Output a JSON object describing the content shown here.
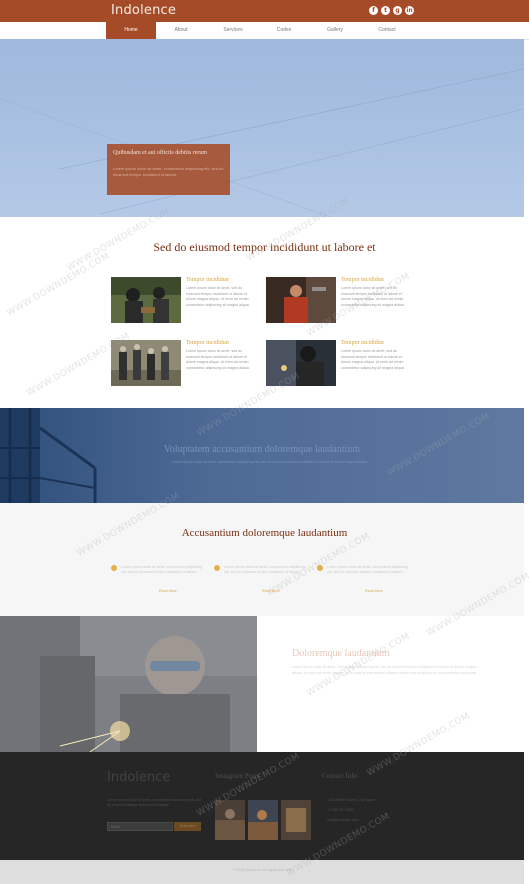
{
  "header": {
    "logo": "Indolence",
    "social_icons": [
      "facebook-icon",
      "twitter-icon",
      "google-plus-icon",
      "linkedin-icon"
    ],
    "accent_color": "#a64b27"
  },
  "nav": {
    "items": [
      {
        "label": "Home",
        "active": true
      },
      {
        "label": "About",
        "active": false
      },
      {
        "label": "Services",
        "active": false
      },
      {
        "label": "Codes",
        "active": false
      },
      {
        "label": "Gallery",
        "active": false
      },
      {
        "label": "Contact",
        "active": false
      }
    ]
  },
  "hero": {
    "title": "Quibusdam et aut officiis debitis rerum",
    "text": "Lorem ipsum dolor sit amet, consectetur adipiscing elit, sed do eiusmod tempor incididunt ut labore."
  },
  "features": {
    "heading": "Sed do eiusmod tempor incididunt ut labore et",
    "items": [
      {
        "title": "Tempor incididun",
        "text": "Lorem ipsum dolor sit amet, sed do eiusmod tempor incididunt ut labore et dolore magna aliqua. Ut enim ad minim consectetur adipiscing sit magna aliqua."
      },
      {
        "title": "Tempor incididun",
        "text": "Lorem ipsum dolor sit amet, sed do eiusmod tempor incididunt ut labore et dolore magna aliqua. Ut enim ad minim consectetur adipiscing sit magna aliqua."
      },
      {
        "title": "Tempor incididun",
        "text": "Lorem ipsum dolor sit amet, sed do eiusmod tempor incididunt ut labore et dolore magna aliqua. Ut enim ad minim consectetur adipiscing sit magna aliqua."
      },
      {
        "title": "Tempor incididun",
        "text": "Lorem ipsum dolor sit amet, sed do eiusmod tempor incididunt ut labore et dolore magna aliqua. Ut enim ad minim consectetur adipiscing sit magna aliqua."
      }
    ]
  },
  "banner": {
    "title": "Voluptatem accusantium doloremque laudantium",
    "text": "Lorem ipsum dolor sit amet, consectetur adipiscing elit, sed do eiusmod tempor incididunt ut labore et dolore magna aliqua."
  },
  "services": {
    "heading": "Accusantium doloremque laudantium",
    "items": [
      {
        "text": "Lorem ipsum dolor sit amet, consectetur adipiscing elit, sed do eiusmod tempor incididunt ut labore.",
        "more": "Read More"
      },
      {
        "text": "Lorem ipsum dolor sit amet, consectetur adipiscing elit, sed do eiusmod tempor incididunt ut labore.",
        "more": "Read More"
      },
      {
        "text": "Lorem ipsum dolor sit amet, consectetur adipiscing elit, sed do eiusmod tempor incididunt ut labore.",
        "more": "Read More"
      }
    ]
  },
  "about": {
    "title": "Doloremque laudantium",
    "text": "Lorem ipsum dolor sit amet, consectetur adipiscing elit, sed do eiusmod tempor incididunt ut labore et dolore magna aliqua. Ut enim ad minim veniam, quis nostrud exercitation ullamco laboris nisi ut aliquip ex ea commodo consequat."
  },
  "footer": {
    "logo": "Indolence",
    "text": "Lorem ipsum dolor sit amet, consectetur adipiscing elit, sed do eiusmod tempor incididunt ut labore.",
    "email_placeholder": "Email",
    "subscribe_label": "Subscribe",
    "instagram_heading": "Instagram Posts",
    "contact_heading": "Contact Info",
    "contact_lines": [
      "1234 Street Name, City Name",
      "+1 234 567 8900",
      "mail@example.com"
    ]
  },
  "bottom_bar": {
    "text": "© 2016 Indolence. All rights reserved"
  },
  "watermark": "WWW.DOWNDEMO.COM"
}
